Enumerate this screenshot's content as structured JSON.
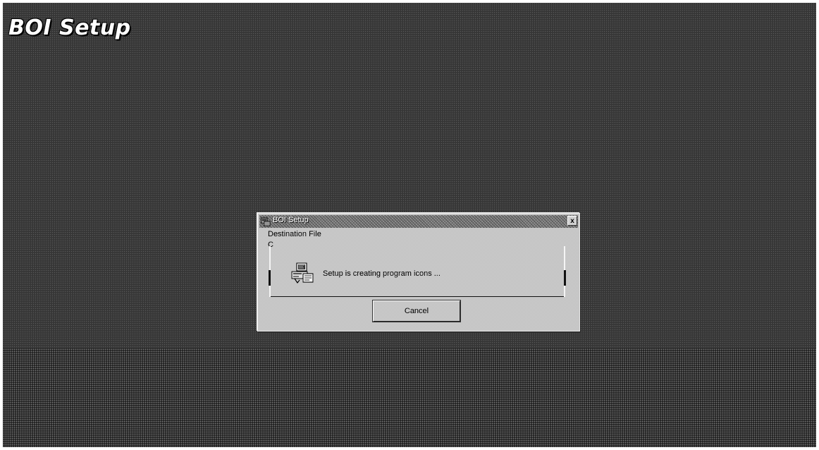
{
  "app": {
    "title": "BOI Setup"
  },
  "dialog": {
    "title": "BOI Setup",
    "icon": "setup-app-icon",
    "close_label": "x",
    "destination_label": "Destination File",
    "destination_value": "C",
    "status_icon": "computer-install-icon",
    "status_text": "Setup is creating program icons ...",
    "cancel_label": "Cancel"
  },
  "colors": {
    "background": "#3a3a3a",
    "dialog_face": "#c8c8c8",
    "title_text": "#ffffff"
  }
}
